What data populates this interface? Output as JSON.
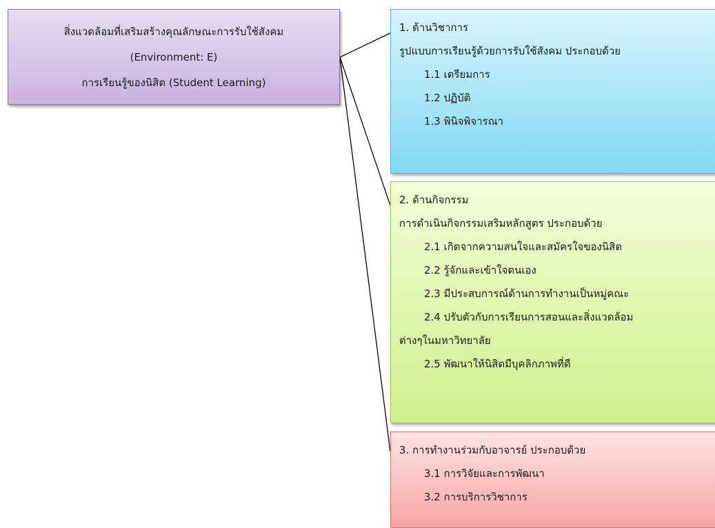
{
  "root": {
    "line1": "สิ่งแวดล้อมที่เสริมสร้างคุณลักษณะการรับใช้สังคม",
    "line2": "(Environment: E)",
    "line3": "การเรียนรู้ของนิสิต (Student Learning)"
  },
  "box1": {
    "title": "1. ด้านวิชาการ",
    "heading": "รูปแบบการเรียนรู้ด้วยการรับใช้สังคม ประกอบด้วย",
    "items": [
      "1.1 เตรียมการ",
      "1.2 ปฏิบัติ",
      "1.3 พินิจพิจารณา"
    ]
  },
  "box2": {
    "title": "2. ด้านกิจกรรม",
    "heading": "การดำเนินกิจกรรมเสริมหลักสูตร ประกอบด้วย",
    "items": [
      "2.1 เกิดจากความสนใจและสมัครใจของนิสิต",
      "2.2 รู้จักและเข้าใจตนเอง",
      "2.3 มีประสบการณ์ด้านการทำงานเป็นหมู่คณะ",
      "2.4 ปรับตัวกับการเรียนการสอนและสิ่งแวดล้อม"
    ],
    "continuation": "ต่างๆในมหาวิทยาลัย",
    "last_item": "2.5 พัฒนาให้นิสิตมีบุคลิกภาพที่ดี"
  },
  "box3": {
    "title": "3. การทำงานร่วมกับอาจารย์ ประกอบด้วย",
    "items": [
      "3.1 การวิจัยและการพัฒนา",
      "3.2 การบริการวิชาการ"
    ]
  },
  "colors": {
    "root_fill": "#c8b2e0",
    "box1_fill": "#7fd8f2",
    "box2_fill": "#cdf08a",
    "box3_fill": "#f7a5a5",
    "connector": "#000000"
  }
}
